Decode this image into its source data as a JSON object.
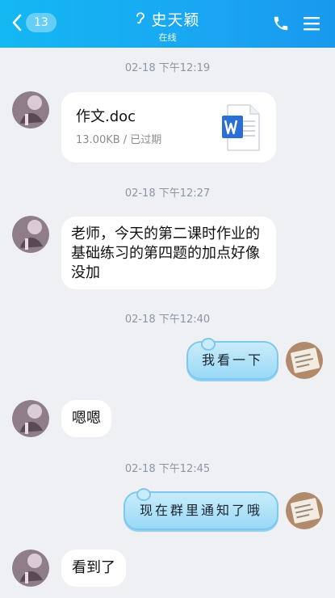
{
  "header": {
    "back_count": "13",
    "contact_name": "史天颖",
    "status": "在线",
    "icons": {
      "back": "back-arrow-icon",
      "ear": "ear-icon",
      "call": "phone-icon",
      "menu": "menu-icon"
    },
    "colors": {
      "bar": "#14b3f2",
      "text": "#ffffff"
    }
  },
  "messages": {
    "t1": "02-18 下午12:19",
    "file_name": "作文.doc",
    "file_meta": "13.00KB / 已过期",
    "t2": "02-18 下午12:27",
    "msg1": "老师，今天的第二课时作业的基础练习的第四题的加点好像没加",
    "t3": "02-18 下午12:40",
    "reply1": "我看一下",
    "msg2": "嗯嗯",
    "t4": "02-18 下午12:45",
    "reply2": "现在群里通知了哦",
    "msg3": "看到了"
  }
}
